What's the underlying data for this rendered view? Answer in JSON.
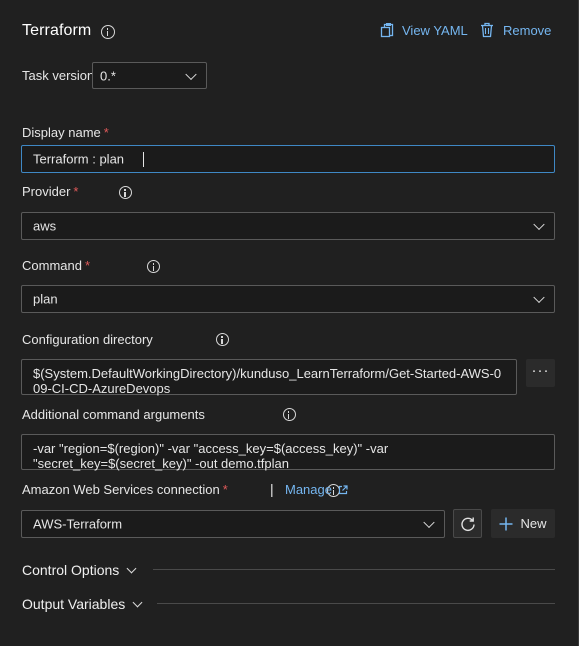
{
  "header": {
    "title": "Terraform",
    "view_yaml_label": "View YAML",
    "remove_label": "Remove"
  },
  "task_version": {
    "label": "Task version",
    "value": "0.*"
  },
  "display_name": {
    "label": "Display name",
    "required_mark": "*",
    "value": "Terraform : plan"
  },
  "provider": {
    "label": "Provider",
    "required_mark": "*",
    "value": "aws"
  },
  "command": {
    "label": "Command",
    "required_mark": "*",
    "value": "plan"
  },
  "configuration_directory": {
    "label": "Configuration directory",
    "value": "$(System.DefaultWorkingDirectory)/kunduso_LearnTerraform/Get-Started-AWS-009-CI-CD-AzureDevops",
    "browse_label": "···"
  },
  "additional_args": {
    "label": "Additional command arguments",
    "value": "-var \"region=$(region)\" -var \"access_key=$(access_key)\" -var \"secret_key=$(secret_key)\" -out demo.tfplan"
  },
  "aws_connection": {
    "label": "Amazon Web Services connection",
    "required_mark": "*",
    "separator": "|",
    "manage_label": "Manage",
    "value": "AWS-Terraform",
    "new_label": "New"
  },
  "sections": {
    "control_options": "Control Options",
    "output_variables": "Output Variables"
  },
  "colors": {
    "background": "#202020",
    "link": "#75b6f0",
    "required": "#e05a5a",
    "focus_border": "#3f88c5"
  }
}
